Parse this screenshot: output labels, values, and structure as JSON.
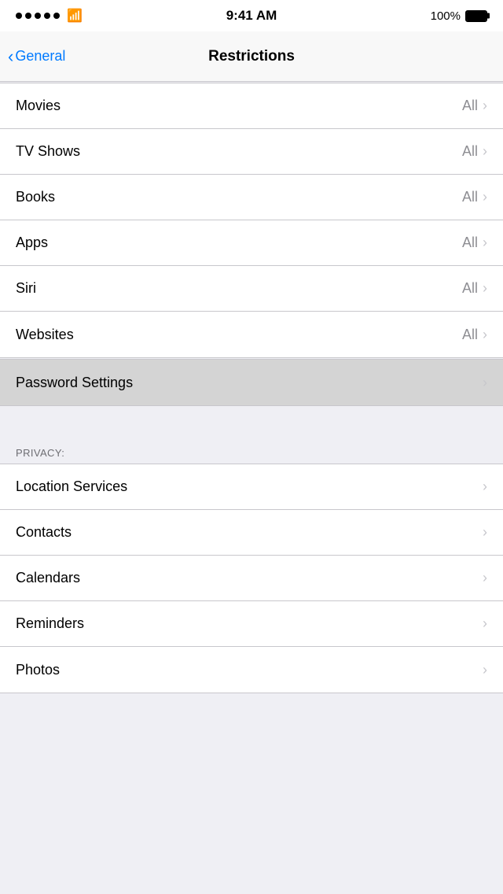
{
  "statusBar": {
    "time": "9:41 AM",
    "battery": "100%",
    "batteryFull": true
  },
  "navBar": {
    "backLabel": "General",
    "title": "Restrictions"
  },
  "contentRatings": {
    "items": [
      {
        "label": "Movies",
        "value": "All"
      },
      {
        "label": "TV Shows",
        "value": "All"
      },
      {
        "label": "Books",
        "value": "All"
      },
      {
        "label": "Apps",
        "value": "All"
      },
      {
        "label": "Siri",
        "value": "All"
      },
      {
        "label": "Websites",
        "value": "All"
      }
    ]
  },
  "passwordSettings": {
    "label": "Password Settings"
  },
  "privacy": {
    "header": "PRIVACY:",
    "items": [
      {
        "label": "Location Services"
      },
      {
        "label": "Contacts"
      },
      {
        "label": "Calendars"
      },
      {
        "label": "Reminders"
      },
      {
        "label": "Photos"
      }
    ]
  },
  "icons": {
    "chevronRight": "›",
    "backChevron": "‹"
  }
}
